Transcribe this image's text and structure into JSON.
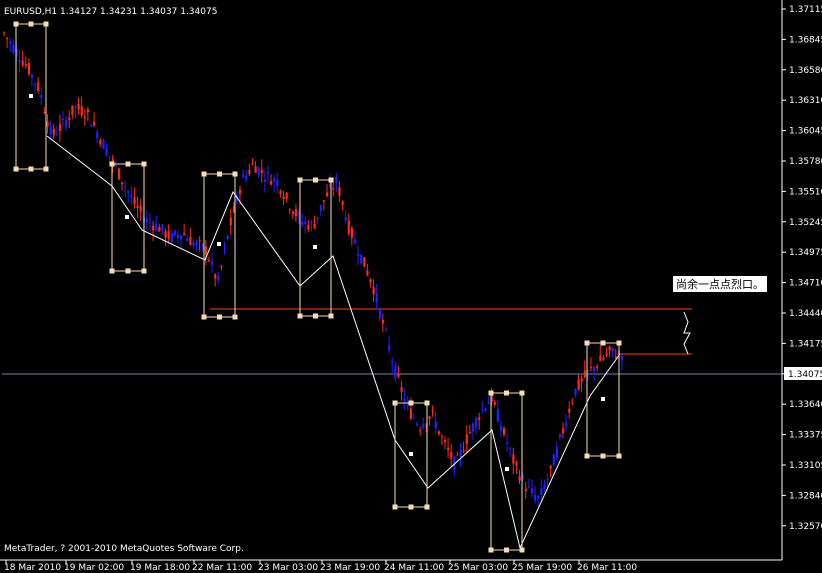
{
  "header": {
    "symbol_info": "EURUSD,H1  1.34127 1.34231 1.34037 1.34075"
  },
  "footer": {
    "copyright": "MetaTrader, ? 2001-2010 MetaQuotes Software Corp."
  },
  "annotation": {
    "text": "尚余一点点烈口。"
  },
  "price_axis": {
    "ticks": [
      "1.37115",
      "1.36845",
      "1.36580",
      "1.36310",
      "1.36045",
      "1.35780",
      "1.35510",
      "1.35245",
      "1.34975",
      "1.34710",
      "1.34440",
      "1.34175",
      "1.33905",
      "1.33640",
      "1.33375",
      "1.33105",
      "1.32840",
      "1.32570"
    ],
    "current_price": "1.34075"
  },
  "time_axis": {
    "ticks": [
      "18 Mar 2010",
      "19 Mar 02:00",
      "19 Mar 18:00",
      "22 Mar 11:00",
      "23 Mar 03:00",
      "23 Mar 19:00",
      "24 Mar 11:00",
      "25 Mar 03:00",
      "25 Mar 19:00",
      "26 Mar 11:00"
    ]
  },
  "colors": {
    "background": "#000000",
    "bull": "#ff2a1a",
    "bear": "#1e22ff",
    "grid_text": "#ffffff",
    "frame": "#f5deb3",
    "zigzag": "#ffffff",
    "level_line": "#ff4500",
    "current_line": "#6f86a8"
  },
  "chart_data": {
    "type": "candlestick",
    "symbol": "EURUSD",
    "timeframe": "H1",
    "ohlc_last": {
      "open": 1.34127,
      "high": 1.34231,
      "low": 1.34037,
      "close": 1.34075
    },
    "ylim": [
      1.3257,
      1.37115
    ],
    "price_series": [
      1.369,
      1.3675,
      1.366,
      1.364,
      1.36,
      1.361,
      1.3625,
      1.362,
      1.36,
      1.358,
      1.356,
      1.354,
      1.3525,
      1.352,
      1.351,
      1.3515,
      1.3505,
      1.35,
      1.347,
      1.352,
      1.356,
      1.3575,
      1.3565,
      1.356,
      1.354,
      1.3525,
      1.352,
      1.3545,
      1.356,
      1.352,
      1.3495,
      1.347,
      1.343,
      1.339,
      1.336,
      1.3345,
      1.3355,
      1.333,
      1.331,
      1.3335,
      1.3355,
      1.337,
      1.334,
      1.331,
      1.329,
      1.328,
      1.3305,
      1.334,
      1.3375,
      1.339,
      1.34,
      1.341,
      1.34075
    ],
    "levels": [
      1.3465,
      1.3418
    ]
  }
}
